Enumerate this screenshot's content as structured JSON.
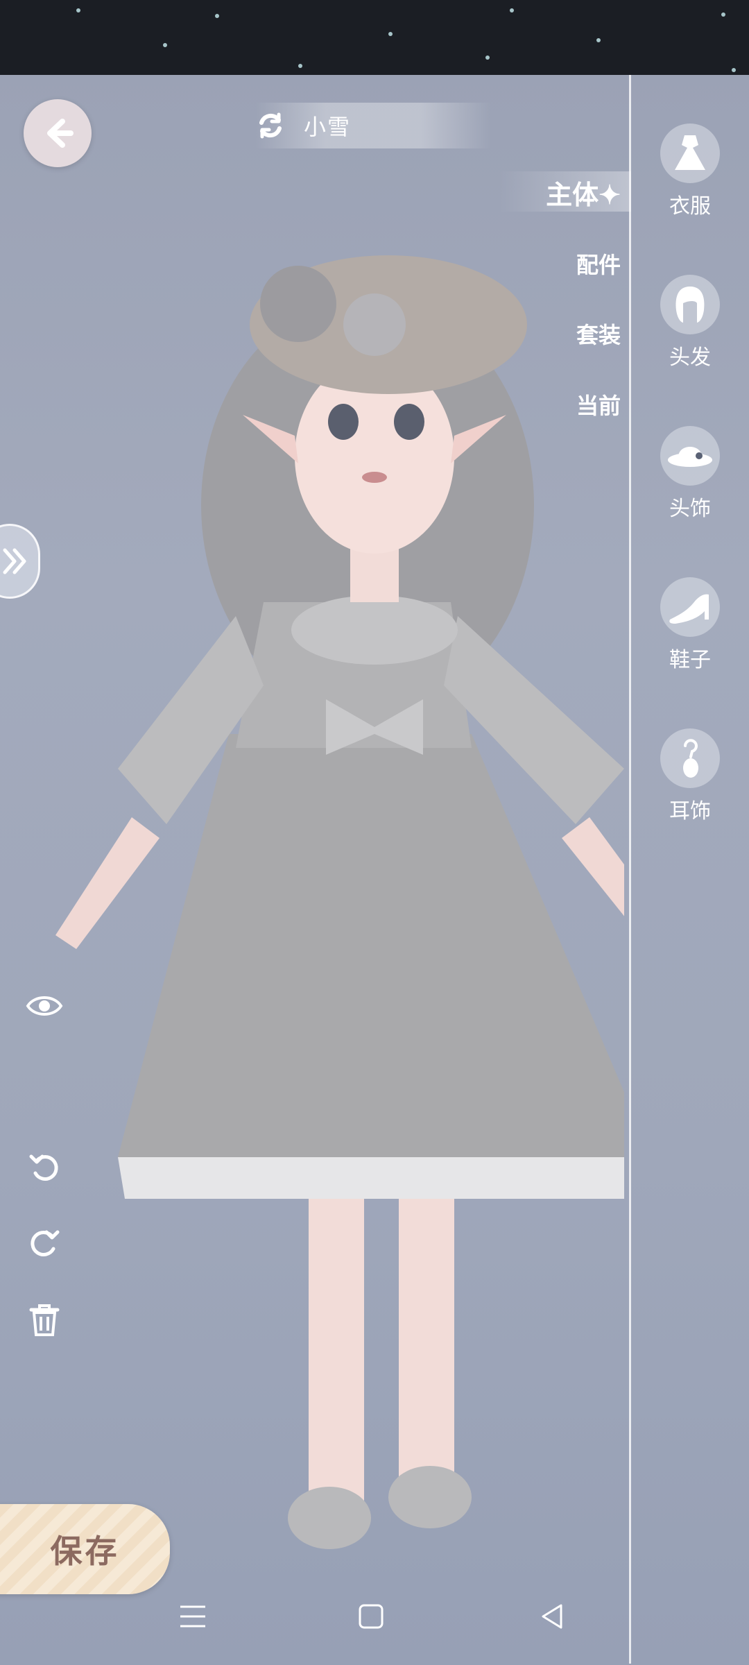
{
  "header": {
    "title": "小雪",
    "back_icon": "arrow-left-icon",
    "switch_icon": "refresh-icon"
  },
  "categories": [
    {
      "label": "主体✦",
      "active": true
    },
    {
      "label": "配件",
      "active": false
    },
    {
      "label": "套装",
      "active": false
    },
    {
      "label": "当前",
      "active": false
    }
  ],
  "sidebar": {
    "items": [
      {
        "label": "衣服",
        "icon": "dress-icon"
      },
      {
        "label": "头发",
        "icon": "hair-icon"
      },
      {
        "label": "头饰",
        "icon": "hat-icon"
      },
      {
        "label": "鞋子",
        "icon": "shoe-icon"
      },
      {
        "label": "耳饰",
        "icon": "earring-icon"
      }
    ]
  },
  "tools": {
    "expand_icon": "chevron-double-right-icon",
    "preview_icon": "eye-icon",
    "undo_icon": "undo-icon",
    "redo_icon": "redo-icon",
    "delete_icon": "trash-icon"
  },
  "save": {
    "label": "保存"
  },
  "nav": {
    "menu_icon": "menu-icon",
    "home_icon": "home-icon",
    "back_icon": "back-triangle-icon"
  },
  "colors": {
    "background": "#a3aabc",
    "topbar": "#1b1e24",
    "save_text": "#8c6a60"
  }
}
